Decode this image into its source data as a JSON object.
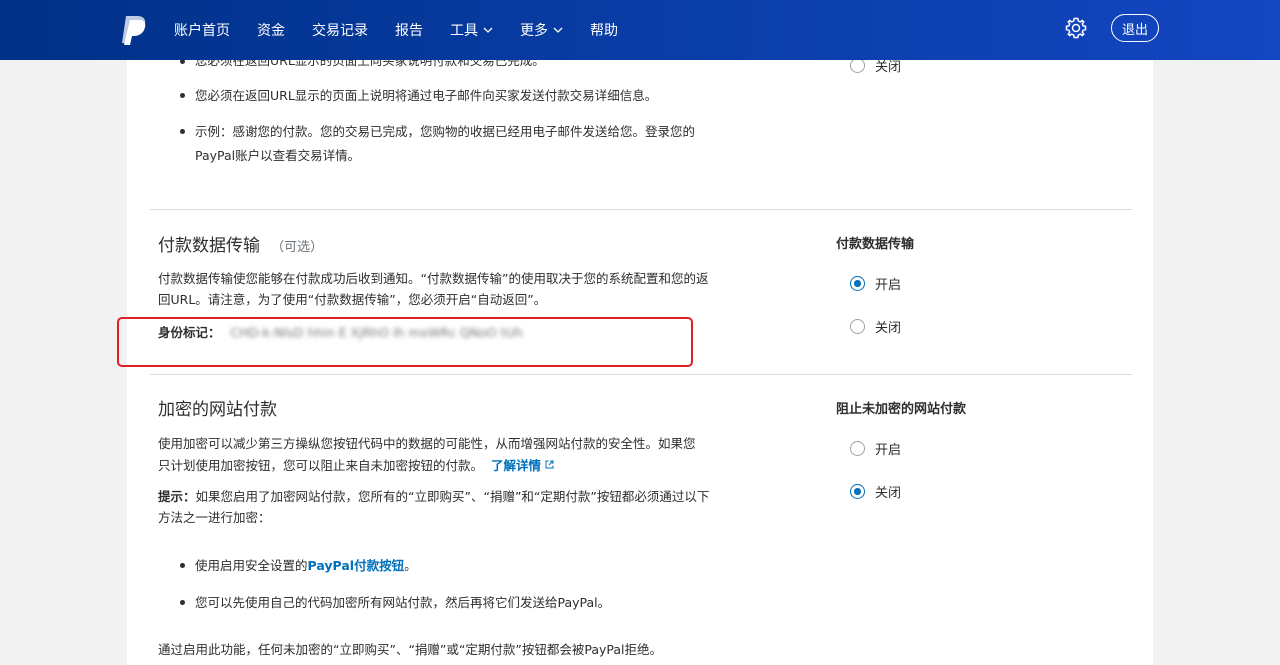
{
  "nav": {
    "items": [
      {
        "label": "账户首页",
        "dropdown": false
      },
      {
        "label": "资金",
        "dropdown": false
      },
      {
        "label": "交易记录",
        "dropdown": false
      },
      {
        "label": "报告",
        "dropdown": false
      },
      {
        "label": "工具",
        "dropdown": true
      },
      {
        "label": "更多",
        "dropdown": true
      },
      {
        "label": "帮助",
        "dropdown": false
      }
    ],
    "settings_icon": "gear-icon",
    "logout_label": "退出"
  },
  "return_section": {
    "top_option_label": "关闭",
    "bullets": [
      "您必须在返回URL显示的页面上向买家说明付款和交易已完成。",
      "您必须在返回URL显示的页面上说明将通过电子邮件向买家发送付款交易详细信息。",
      "示例：感谢您的付款。您的交易已完成，您购物的收据已经用电子邮件发送给您。登录您的",
      "PayPal账户以查看交易详情。"
    ]
  },
  "pdt": {
    "title": "付款数据传输",
    "optional": "（可选）",
    "desc_line1": "付款数据传输使您能够在付款成功后收到通知。“付款数据传输”的使用取决于您的系统配置和您的返",
    "desc_line2": "回URL。请注意，为了使用“付款数据传输”，您必须开启“自动返回”。",
    "token_label": "身份标记：",
    "token_value": "CHD-k-NlsD  hhin    E   XjRhO  Ih   mxWRc  QNoO      tUh",
    "right_title": "付款数据传输",
    "options": [
      {
        "label": "开启",
        "selected": true
      },
      {
        "label": "关闭",
        "selected": false
      }
    ]
  },
  "encrypted": {
    "title": "加密的网站付款",
    "desc_line1": "使用加密可以减少第三方操纵您按钮代码中的数据的可能性，从而增强网站付款的安全性。如果您",
    "desc_line2": "只计划使用加密按钮，您可以阻止来自未加密按钮的付款。",
    "learn_more": "了解详情",
    "tip_label": "提示：",
    "tip_line1": "如果您启用了加密网站付款，您所有的“立即购买”、“捐赠”和“定期付款”按钮都必须通过以下",
    "tip_line2": "方法之一进行加密：",
    "bullet1_pre": "使用启用安全设置的",
    "bullet1_link": "PayPal付款按钮",
    "bullet1_post": "。",
    "bullet2": "您可以先使用自己的代码加密所有网站付款，然后再将它们发送给PayPal。",
    "footer": "通过启用此功能，任何未加密的“立即购买”、“捐赠”或“定期付款”按钮都会被PayPal拒绝。",
    "right_title": "阻止未加密的网站付款",
    "options": [
      {
        "label": "开启",
        "selected": false
      },
      {
        "label": "关闭",
        "selected": true
      }
    ]
  },
  "colors": {
    "nav_bg": "#003087",
    "accent": "#0070ba",
    "highlight_box": "#e02020"
  }
}
